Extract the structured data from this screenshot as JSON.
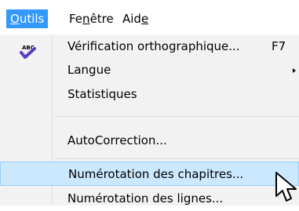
{
  "menubar": {
    "items": [
      {
        "label": "Outils",
        "mnemonic": "O",
        "active": true
      },
      {
        "label": "Fenêtre",
        "mnemonic": "n"
      },
      {
        "label": "Aide",
        "mnemonic": "e"
      }
    ]
  },
  "menu": {
    "items": [
      {
        "label": "Vérification orthographique...",
        "shortcut": "F7",
        "icon": "spellcheck-icon"
      },
      {
        "label": "Langue",
        "submenu": true
      },
      {
        "label": "Statistiques"
      },
      {
        "label": "AutoCorrection..."
      },
      {
        "label": "Numérotation des chapitres...",
        "highlighted": true
      },
      {
        "label": "Numérotation des lignes..."
      }
    ],
    "icon_text": "ABC"
  },
  "colors": {
    "menubar_active": "#3399ff",
    "highlight_bg": "#cce8ff",
    "highlight_border": "#99ccff",
    "menu_bg": "#f2f2f2"
  }
}
